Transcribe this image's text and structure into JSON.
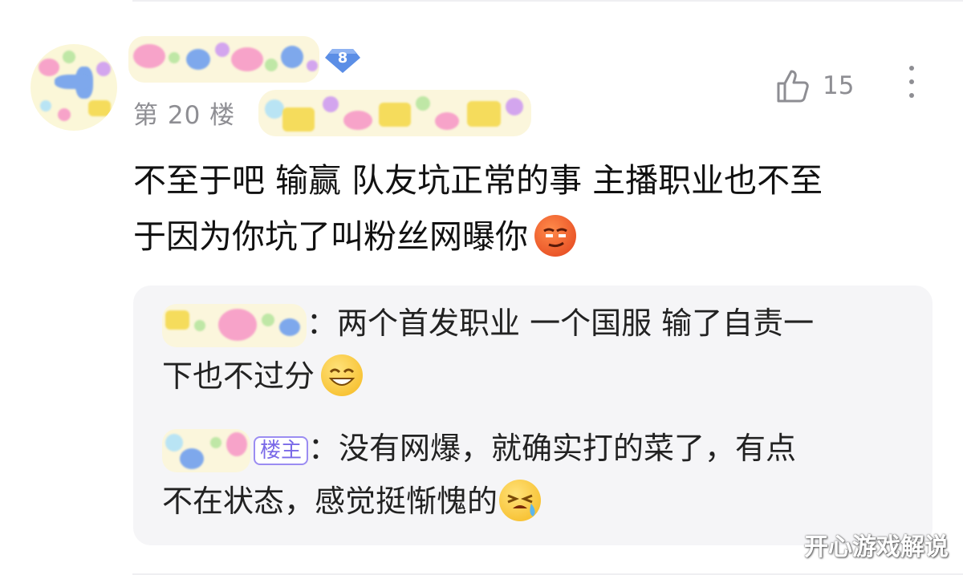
{
  "comment": {
    "floor_label": "第 20 楼",
    "level": "8",
    "like_count": "15",
    "text_line1": "不至于吧 输赢 队友坑正常的事 主播职业也不至",
    "text_line2": "于因为你坑了叫粉丝网曝你",
    "emoji1": "smirk-emoji"
  },
  "replies": [
    {
      "sep": "：",
      "text_line1": "两个首发职业 一个国服 输了自责一",
      "text_line2": "下也不过分",
      "emoji": "grin-emoji"
    },
    {
      "tag": "楼主",
      "sep": "：",
      "text_line1": "没有网爆，就确实打的菜了，有点",
      "text_line2": "不在状态，感觉挺惭愧的",
      "emoji": "cry-laugh-emoji"
    }
  ],
  "watermark": "开心游戏解说",
  "colors": {
    "tag_purple": "#7a6ae8",
    "level_blue": "#5b8ee6",
    "muted_gray": "#8e8e93",
    "reply_bg": "#f5f5f7"
  }
}
